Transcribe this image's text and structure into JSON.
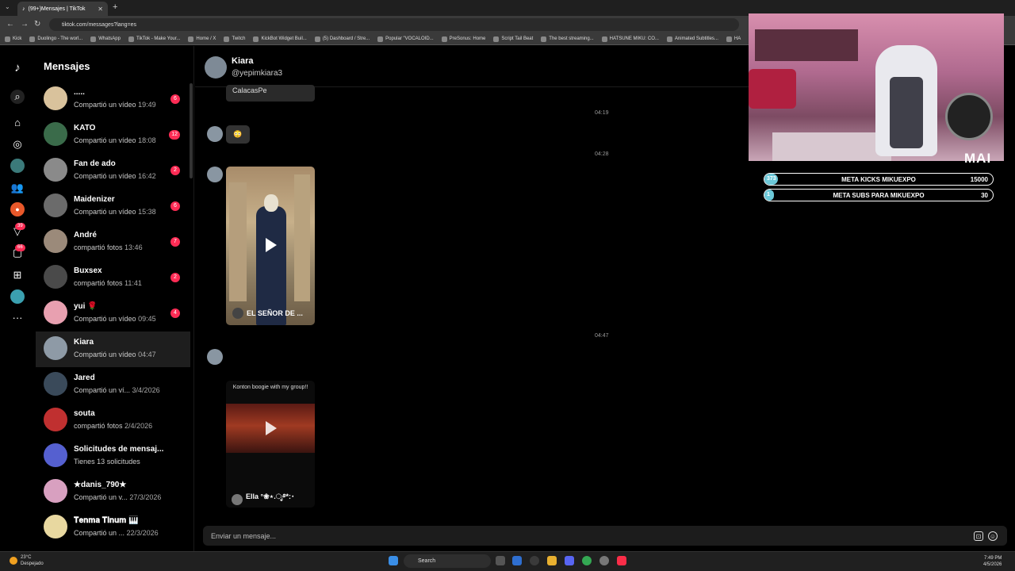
{
  "browser": {
    "tab_title": "(99+)Mensajes | TikTok",
    "url": "tiktok.com/messages?lang=es",
    "bookmarks": [
      "Kick",
      "Duolingo - The worl...",
      "WhatsApp",
      "TikTok - Make Your...",
      "Home / X",
      "Twitch",
      "KickBot Widget Buil...",
      "(5) Dashboard / Stre...",
      "Popular \"VOCALOID...",
      "PreSonus: Home",
      "Script Tail Beat",
      "The best streaming...",
      "HATSUNE MIKU: CO...",
      "Animated Subtitles...",
      "HA"
    ]
  },
  "rail": {
    "notif_badge": "39",
    "inbox_badge": "66"
  },
  "list": {
    "title": "Mensajes",
    "items": [
      {
        "name": ".....",
        "sub": "Compartió un vídeo",
        "time": "19:49",
        "count": "6"
      },
      {
        "name": "KATO",
        "sub": "Compartió un vídeo",
        "time": "18:08",
        "count": "12"
      },
      {
        "name": "Fan de ado",
        "sub": "Compartió un vídeo",
        "time": "16:42",
        "count": "2"
      },
      {
        "name": "Maidenizer",
        "sub": "Compartió un vídeo",
        "time": "15:38",
        "count": "6"
      },
      {
        "name": "André",
        "sub": "compartió fotos",
        "time": "13:46",
        "count": "7"
      },
      {
        "name": "Buxsex",
        "sub": "compartió fotos",
        "time": "11:41",
        "count": "2"
      },
      {
        "name": "yui 🌹",
        "sub": "Compartió un vídeo",
        "time": "09:45",
        "count": "4"
      },
      {
        "name": "Kiara",
        "sub": "Compartió un vídeo",
        "time": "04:47",
        "count": ""
      },
      {
        "name": "Jared",
        "sub": "Compartió un ví...",
        "time": "3/4/2026",
        "count": ""
      },
      {
        "name": "souta",
        "sub": "compartió fotos",
        "time": "2/4/2026",
        "count": ""
      },
      {
        "name": "Solicitudes de mensaj...",
        "sub": "Tienes 13 solicitudes",
        "time": "",
        "count": ""
      },
      {
        "name": "★danis_790★",
        "sub": "Compartió un v...",
        "time": "27/3/2026",
        "count": ""
      },
      {
        "name": "𝐓𝐞𝐧𝐦𝐚 𝐓𝐢𝐧𝐮𝐦 🎹",
        "sub": "Compartió un ...",
        "time": "22/3/2026",
        "count": ""
      }
    ]
  },
  "chat": {
    "name": "Kiara",
    "handle": "@yepimkiara3",
    "card1_label": "CalacasPe",
    "emoji": "😳",
    "ts1": "04:19",
    "ts2": "04:28",
    "ts3": "04:47",
    "video1_caption": "EL SEÑOR DE ...",
    "video2_title": "Konton boogie with my group!!",
    "video2_caption": "Ella °❀⋆.ೃ࿔*:･",
    "input_placeholder": "Enviar un mensaje..."
  },
  "overlay": {
    "tag": "MAI",
    "meta_kicks": {
      "current": "373",
      "label": "META KICKS MIKUEXPO",
      "goal": "15000",
      "progress": 0.025
    },
    "meta_subs": {
      "current": "1",
      "label": "META SUBS PARA MIKUEXPO",
      "goal": "30",
      "progress": 0.033
    }
  },
  "taskbar": {
    "temp": "23°C",
    "weather": "Despejado",
    "search": "Search",
    "time": "7:49 PM",
    "date": "4/5/2026"
  }
}
